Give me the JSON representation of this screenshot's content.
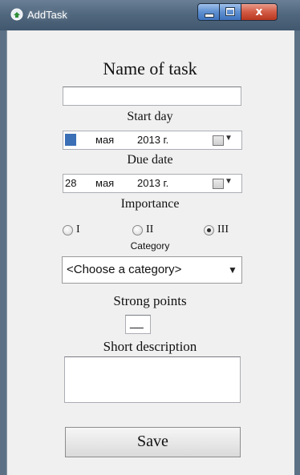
{
  "window": {
    "title": "AddTask",
    "close_glyph": "x"
  },
  "form": {
    "name_label": "Name of task",
    "name_value": "",
    "start_day": {
      "label": "Start day",
      "day": "",
      "month": "мая",
      "year": "2013 г."
    },
    "due_date": {
      "label": "Due date",
      "day": "28",
      "month": "мая",
      "year": "2013 г."
    },
    "importance": {
      "label": "Importance",
      "options": [
        "I",
        "II",
        "III"
      ],
      "selected": "III"
    },
    "category": {
      "label": "Category",
      "selected": "<Choose a category>"
    },
    "strong_points": {
      "label": "Strong points",
      "value": "__"
    },
    "short_description": {
      "label": "Short description",
      "value": ""
    },
    "save_label": "Save"
  },
  "icons": {
    "app": "app-icon",
    "calendar": "calendar-icon",
    "dropdown": "chevron-down-icon"
  },
  "colors": {
    "titlebar": "#4f667d",
    "close_button": "#c8432a",
    "selection": "#3b6fb6",
    "form_background": "#f0f0f0"
  }
}
